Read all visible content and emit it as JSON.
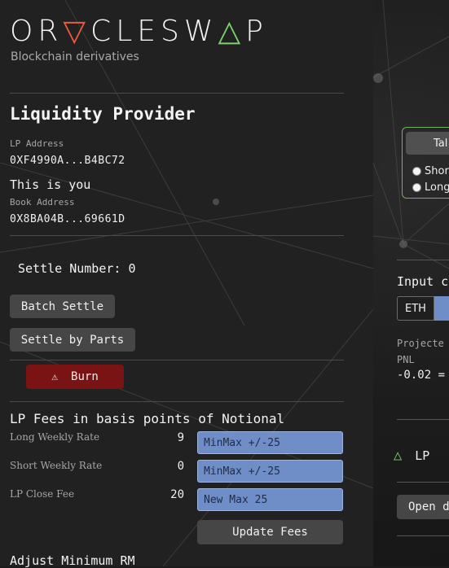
{
  "brand": {
    "logo_text": "OR▽CLESW△P",
    "tagline": "Blockchain derivatives"
  },
  "lp": {
    "title": "Liquidity Provider",
    "address_label": "LP Address",
    "address_value": "0XF4990A...B4BC72",
    "this_is_you": "This is you",
    "book_label": "Book Address",
    "book_value": "0X8BA04B...69661D"
  },
  "settle": {
    "number_text": "Settle Number: 0",
    "batch_label": "Batch Settle",
    "parts_label": "Settle by Parts",
    "burn_label": "Burn"
  },
  "fees": {
    "title": "LP Fees in basis points of Notional",
    "rows": [
      {
        "label": "Long Weekly Rate",
        "value": "9",
        "placeholder": "MinMax +/-25"
      },
      {
        "label": "Short Weekly Rate",
        "value": "0",
        "placeholder": "MinMax +/-25"
      },
      {
        "label": "LP Close Fee",
        "value": "20",
        "placeholder": "New Max 25"
      }
    ],
    "update_label": "Update Fees"
  },
  "adjust_title": "Adjust Minimum RM",
  "right": {
    "tab_label": "Tal",
    "radio_short": "Shor",
    "radio_long": "Long",
    "input_label": "Input c",
    "eth_label": "ETH",
    "projected_label": "Projecte",
    "pnl_label": "PNL",
    "pnl_value": "-0.02 =",
    "lp_label": "LP",
    "open_label": "Open d"
  },
  "colors": {
    "accent_red": "#ef5a3c",
    "accent_green": "#7bd36b",
    "input_blue": "#6f8ec7",
    "burn_red": "#7a1414"
  },
  "icons": {
    "warning": "warning-icon",
    "lp_triangle": "triangle-up-icon"
  }
}
